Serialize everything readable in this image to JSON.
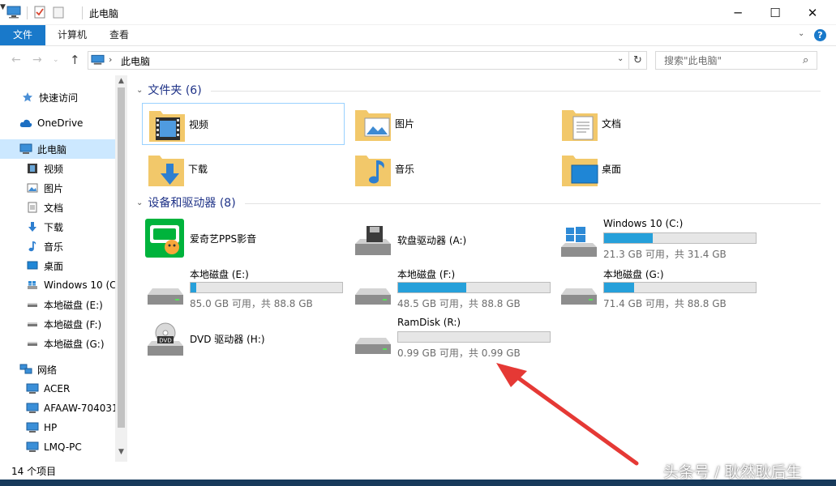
{
  "window": {
    "title": "此电脑",
    "minimize": "─",
    "maximize": "☐",
    "close": "✕"
  },
  "ribbon": {
    "tabs": [
      {
        "label": "文件"
      },
      {
        "label": "计算机"
      },
      {
        "label": "查看"
      }
    ],
    "help": "?"
  },
  "address": {
    "path": "此电脑"
  },
  "search": {
    "placeholder": "搜索\"此电脑\""
  },
  "sidebar": {
    "items": [
      {
        "label": "快速访问",
        "icon": "star-icon"
      },
      {
        "label": "OneDrive",
        "icon": "cloud-icon"
      },
      {
        "label": "此电脑",
        "icon": "computer-icon",
        "selected": true
      },
      {
        "label": "视频",
        "icon": "video-icon"
      },
      {
        "label": "图片",
        "icon": "picture-icon"
      },
      {
        "label": "文档",
        "icon": "document-icon"
      },
      {
        "label": "下载",
        "icon": "download-icon"
      },
      {
        "label": "音乐",
        "icon": "music-icon"
      },
      {
        "label": "桌面",
        "icon": "desktop-icon"
      },
      {
        "label": "Windows 10 (C",
        "icon": "windows-drive-icon"
      },
      {
        "label": "本地磁盘 (E:)",
        "icon": "drive-icon"
      },
      {
        "label": "本地磁盘 (F:)",
        "icon": "drive-icon"
      },
      {
        "label": "本地磁盘 (G:)",
        "icon": "drive-icon"
      },
      {
        "label": "网络",
        "icon": "network-icon"
      },
      {
        "label": "ACER",
        "icon": "computer-icon"
      },
      {
        "label": "AFAAW-704031",
        "icon": "computer-icon"
      },
      {
        "label": "HP",
        "icon": "computer-icon"
      },
      {
        "label": "LMQ-PC",
        "icon": "computer-icon"
      }
    ]
  },
  "folders_group": {
    "title": "文件夹 (6)",
    "items": [
      {
        "label": "视频",
        "icon": "video-folder-icon"
      },
      {
        "label": "图片",
        "icon": "picture-folder-icon"
      },
      {
        "label": "文档",
        "icon": "document-folder-icon"
      },
      {
        "label": "下载",
        "icon": "download-folder-icon"
      },
      {
        "label": "音乐",
        "icon": "music-folder-icon"
      },
      {
        "label": "桌面",
        "icon": "desktop-folder-icon"
      }
    ]
  },
  "devices_group": {
    "title": "设备和驱动器 (8)",
    "items": [
      {
        "name": "爱奇艺PPS影音",
        "icon": "iqiyi-app-icon"
      },
      {
        "name": "软盘驱动器 (A:)",
        "icon": "floppy-drive-icon"
      },
      {
        "name": "Windows 10 (C:)",
        "free": "21.3 GB 可用，共 31.4 GB",
        "used_fraction": 0.32,
        "icon": "windows-drive-icon"
      },
      {
        "name": "本地磁盘 (E:)",
        "free": "85.0 GB 可用，共 88.8 GB",
        "used_fraction": 0.04,
        "icon": "hard-drive-icon"
      },
      {
        "name": "本地磁盘 (F:)",
        "free": "48.5 GB 可用，共 88.8 GB",
        "used_fraction": 0.45,
        "icon": "hard-drive-icon"
      },
      {
        "name": "本地磁盘 (G:)",
        "free": "71.4 GB 可用，共 88.8 GB",
        "used_fraction": 0.2,
        "icon": "hard-drive-icon"
      },
      {
        "name": "DVD 驱动器 (H:)",
        "icon": "dvd-drive-icon"
      },
      {
        "name": "RamDisk (R:)",
        "free": "0.99 GB 可用，共 0.99 GB",
        "used_fraction": 0.0,
        "icon": "hard-drive-icon"
      }
    ]
  },
  "status": {
    "count": "14 个项目"
  },
  "watermark": "头条号 / 耿然耿后生",
  "colors": {
    "accent": "#1979ca",
    "bar_fill": "#26a0da",
    "selection": "#cce8ff",
    "annotation_arrow": "#e53935"
  }
}
